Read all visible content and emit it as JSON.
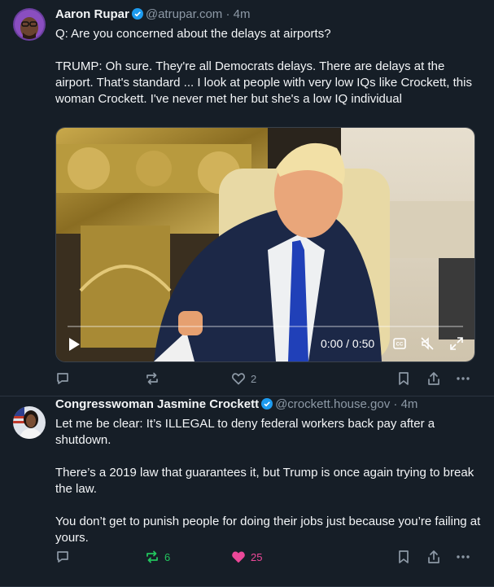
{
  "posts": [
    {
      "author": "Aaron Rupar",
      "handle": "@atrupar.com",
      "separator": "·",
      "time": "4m",
      "text": "Q: Are you concerned about the delays at airports?\n\nTRUMP: Oh sure. They're all Democrats delays. There are delays at the airport. That's standard ... I look at people with very low IQs like Crockett, this woman Crockett. I've never met her but she's a low IQ individual",
      "video": {
        "time_display": "0:00 / 0:50",
        "captions_label": "CC",
        "progress": 0.0
      },
      "actions": {
        "reply_count": "",
        "repost_count": "",
        "like_count": "2"
      }
    },
    {
      "author": "Congresswoman Jasmine Crockett",
      "handle": "@crockett.house.gov",
      "separator": "·",
      "time": "4m",
      "text": "Let me be clear: It’s ILLEGAL to deny federal workers back pay after a shutdown.\n\nThere’s a 2019 law that guarantees it, but Trump is once again trying to break the law.\n\nYou don’t get to punish people for doing their jobs just because you’re failing at yours.",
      "actions": {
        "reply_count": "",
        "repost_count": "6",
        "like_count": "25"
      }
    }
  ],
  "colors": {
    "background": "#161e27",
    "verified": "#1d9bf0",
    "repost_active": "#22c55e",
    "like_active": "#ec4899",
    "muted": "#8d99a6"
  },
  "icons": [
    "reply-icon",
    "repost-icon",
    "heart-icon",
    "bookmark-icon",
    "share-icon",
    "more-icon",
    "play-icon",
    "captions-icon",
    "mute-icon",
    "fullscreen-icon",
    "verified-badge-icon"
  ]
}
